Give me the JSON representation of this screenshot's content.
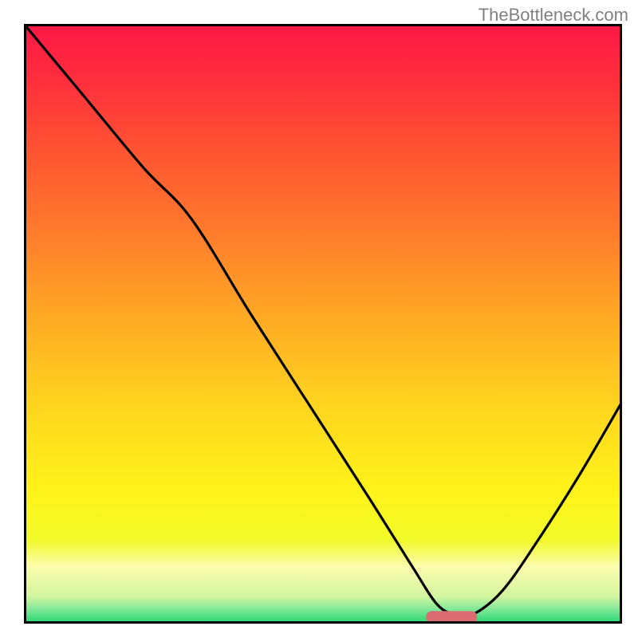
{
  "watermark": "TheBottleneck.com",
  "chart_data": {
    "type": "line",
    "title": "",
    "xlabel": "",
    "ylabel": "",
    "xlim": [
      0,
      100
    ],
    "ylim": [
      0,
      100
    ],
    "series": [
      {
        "name": "bottleneck-curve",
        "x": [
          0,
          10,
          20,
          28,
          38,
          48,
          58,
          65,
          69,
          72,
          75,
          80,
          86,
          93,
          100
        ],
        "y": [
          100,
          88,
          76,
          67.5,
          51.5,
          36,
          20.5,
          9.4,
          3.3,
          1.5,
          1.5,
          5.5,
          14,
          25,
          37
        ]
      }
    ],
    "gradient_bands": [
      {
        "stop": 0.0,
        "color": "#ff1846"
      },
      {
        "stop": 0.08,
        "color": "#ff2a3e"
      },
      {
        "stop": 0.2,
        "color": "#ff5033"
      },
      {
        "stop": 0.35,
        "color": "#ff7c2b"
      },
      {
        "stop": 0.5,
        "color": "#ffad24"
      },
      {
        "stop": 0.65,
        "color": "#ffd81e"
      },
      {
        "stop": 0.78,
        "color": "#fff31a"
      },
      {
        "stop": 0.86,
        "color": "#f1fa28"
      },
      {
        "stop": 0.905,
        "color": "#fcfcae"
      },
      {
        "stop": 0.955,
        "color": "#d2f59f"
      },
      {
        "stop": 0.975,
        "color": "#85e999"
      },
      {
        "stop": 1.0,
        "color": "#22d672"
      }
    ],
    "marker": {
      "x": 71.5,
      "y": 1,
      "width": 8.5,
      "height": 2.2,
      "color": "#db6c74"
    },
    "axes": {
      "frame": true,
      "frame_color": "#000000",
      "frame_width": 3
    }
  }
}
